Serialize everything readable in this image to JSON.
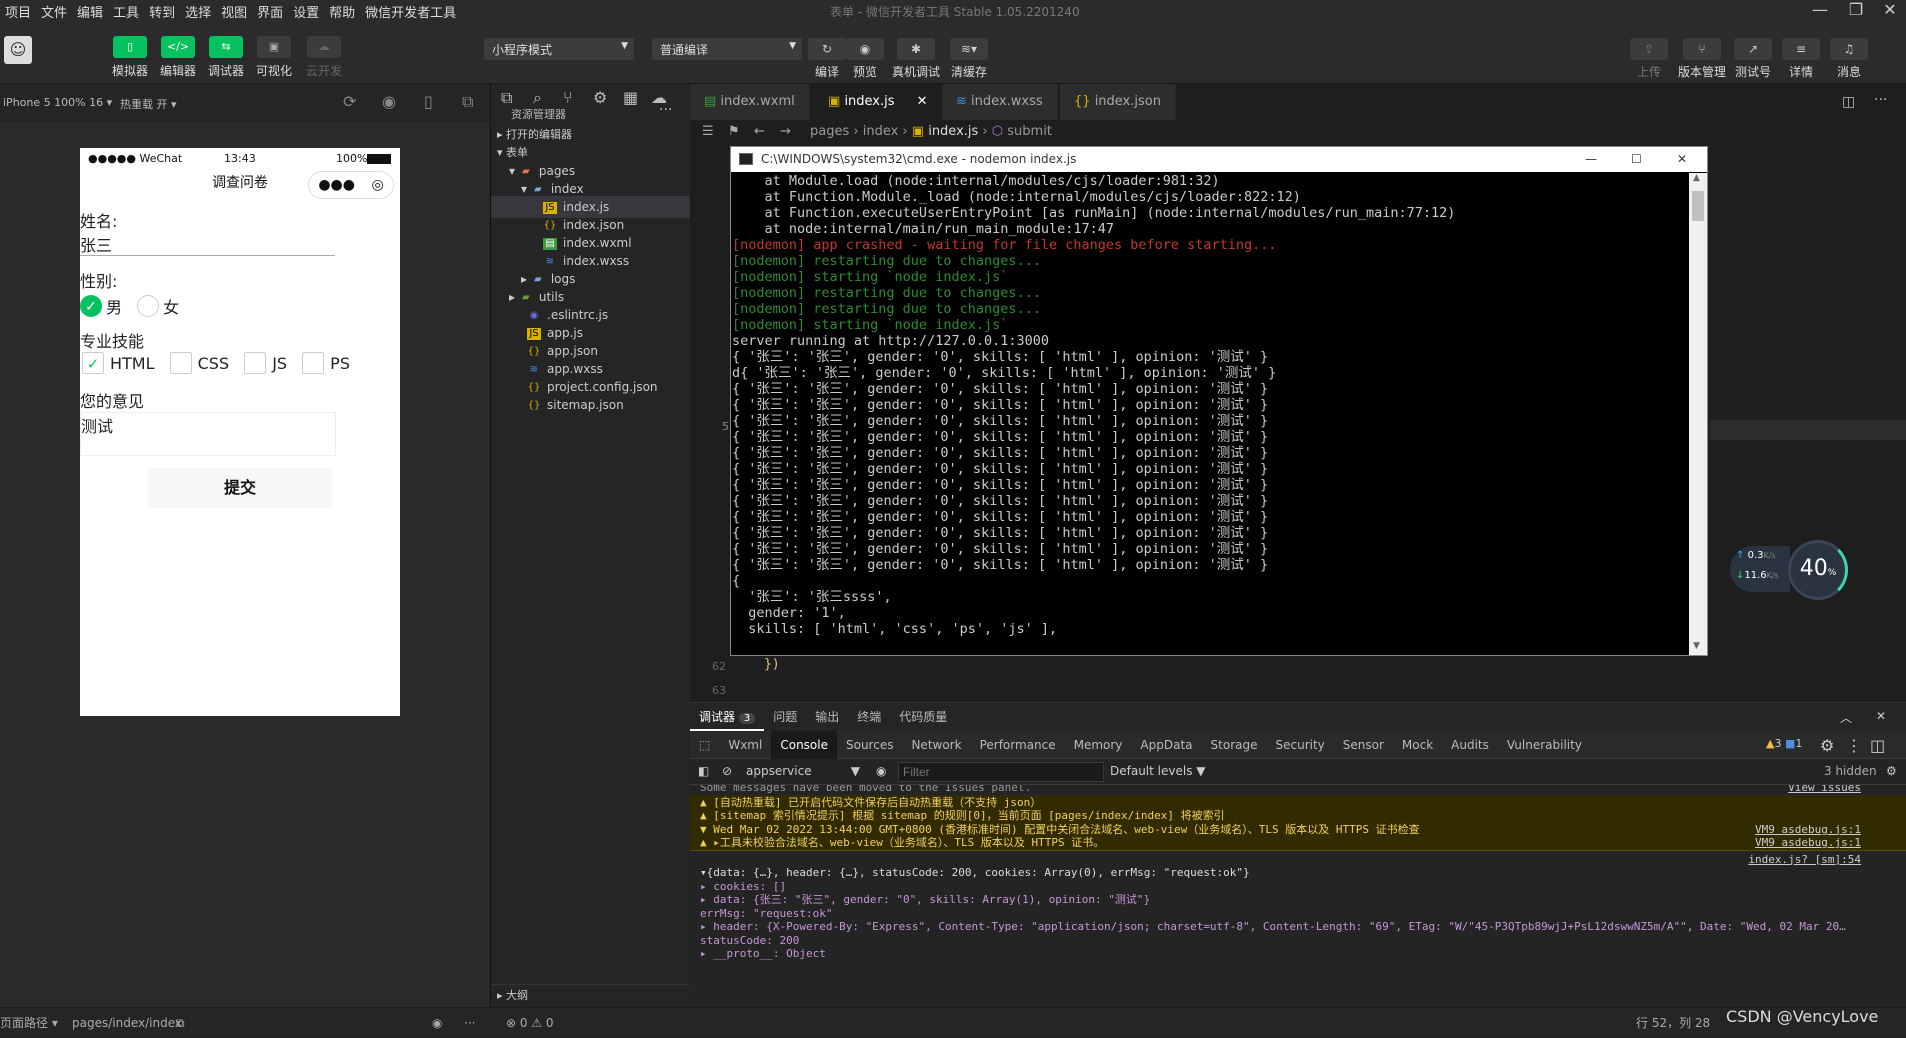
{
  "menu": [
    "项目",
    "文件",
    "编辑",
    "工具",
    "转到",
    "选择",
    "视图",
    "界面",
    "设置",
    "帮助",
    "微信开发者工具"
  ],
  "window_title": "表单 - 微信开发者工具 Stable 1.05.2201240",
  "toolbar": {
    "left": [
      {
        "label": "模拟器",
        "icon": "phone-icon"
      },
      {
        "label": "编辑器",
        "icon": "code-icon"
      },
      {
        "label": "调试器",
        "icon": "debug-icon"
      },
      {
        "label": "可视化",
        "icon": "layout-icon"
      },
      {
        "label": "云开发",
        "icon": "cloud-icon"
      }
    ],
    "mode_select": "小程序模式",
    "compile_select": "普通编译",
    "center": [
      {
        "label": "编译"
      },
      {
        "label": "预览"
      },
      {
        "label": "真机调试"
      },
      {
        "label": "清缓存"
      }
    ],
    "right": [
      {
        "label": "上传"
      },
      {
        "label": "版本管理"
      },
      {
        "label": "测试号"
      },
      {
        "label": "详情"
      },
      {
        "label": "消息"
      }
    ]
  },
  "simbar": {
    "device": "iPhone 5 100% 16",
    "hotreload": "热重载 开"
  },
  "phone": {
    "carrier": "●●●●● WeChat",
    "time": "13:43",
    "battery": "100%",
    "nav_title": "调查问卷",
    "name_label": "姓名:",
    "name_value": "张三",
    "gender_label": "性别:",
    "gender_male": "男",
    "gender_female": "女",
    "skills_label": "专业技能",
    "skills": [
      {
        "label": "HTML",
        "checked": true
      },
      {
        "label": "CSS",
        "checked": false
      },
      {
        "label": "JS",
        "checked": false
      },
      {
        "label": "PS",
        "checked": false
      }
    ],
    "opinion_label": "您的意见",
    "opinion_value": "测试",
    "submit": "提交"
  },
  "explorer": {
    "title": "资源管理器",
    "open_editors": "打开的编辑器",
    "project": "表单",
    "tree": [
      {
        "name": "pages",
        "kind": "folder"
      },
      {
        "name": "index",
        "kind": "folder"
      },
      {
        "name": "index.js",
        "kind": "js"
      },
      {
        "name": "index.json",
        "kind": "json"
      },
      {
        "name": "index.wxml",
        "kind": "wxml"
      },
      {
        "name": "index.wxss",
        "kind": "wxss"
      },
      {
        "name": "logs",
        "kind": "folder"
      },
      {
        "name": "utils",
        "kind": "folder"
      },
      {
        "name": ".eslintrc.js",
        "kind": "eslint"
      },
      {
        "name": "app.js",
        "kind": "js"
      },
      {
        "name": "app.json",
        "kind": "json"
      },
      {
        "name": "app.wxss",
        "kind": "wxss"
      },
      {
        "name": "project.config.json",
        "kind": "json"
      },
      {
        "name": "sitemap.json",
        "kind": "json"
      }
    ],
    "outline": "大纲"
  },
  "editor": {
    "tabs": [
      "index.wxml",
      "index.js",
      "index.wxss",
      "index.json"
    ],
    "breadcrumb": [
      "pages",
      "index",
      "index.js",
      "submit"
    ],
    "line_numbers": [
      "5",
      "62",
      "63"
    ],
    "visible_code": "})"
  },
  "cmd": {
    "title": "C:\\WINDOWS\\system32\\cmd.exe - nodemon  index.js",
    "lines": [
      {
        "t": "    at Module.load (node:internal/modules/cjs/loader:981:32)",
        "c": "#ccc"
      },
      {
        "t": "    at Function.Module._load (node:internal/modules/cjs/loader:822:12)",
        "c": "#ccc"
      },
      {
        "t": "    at Function.executeUserEntryPoint [as runMain] (node:internal/modules/run_main:77:12)",
        "c": "#ccc"
      },
      {
        "t": "    at node:internal/main/run_main_module:17:47",
        "c": "#ccc"
      },
      {
        "t": "[nodemon] app crashed - waiting for file changes before starting...",
        "c": "#c0392b"
      },
      {
        "t": "[nodemon] restarting due to changes...",
        "c": "#2e8b2e"
      },
      {
        "t": "[nodemon] starting `node index.js`",
        "c": "#2e8b2e"
      },
      {
        "t": "[nodemon] restarting due to changes...",
        "c": "#2e8b2e"
      },
      {
        "t": "[nodemon] restarting due to changes...",
        "c": "#2e8b2e"
      },
      {
        "t": "[nodemon] starting `node index.js`",
        "c": "#2e8b2e"
      },
      {
        "t": "server running at http://127.0.0.1:3000",
        "c": "#ccc"
      },
      {
        "t": "{ '张三': '张三', gender: '0', skills: [ 'html' ], opinion: '测试' }",
        "c": "#ccc"
      },
      {
        "t": "d{ '张三': '张三', gender: '0', skills: [ 'html' ], opinion: '测试' }",
        "c": "#ccc"
      },
      {
        "t": "{ '张三': '张三', gender: '0', skills: [ 'html' ], opinion: '测试' }",
        "c": "#ccc"
      },
      {
        "t": "{ '张三': '张三', gender: '0', skills: [ 'html' ], opinion: '测试' }",
        "c": "#ccc"
      },
      {
        "t": "{ '张三': '张三', gender: '0', skills: [ 'html' ], opinion: '测试' }",
        "c": "#ccc"
      },
      {
        "t": "{ '张三': '张三', gender: '0', skills: [ 'html' ], opinion: '测试' }",
        "c": "#ccc"
      },
      {
        "t": "{ '张三': '张三', gender: '0', skills: [ 'html' ], opinion: '测试' }",
        "c": "#ccc"
      },
      {
        "t": "{ '张三': '张三', gender: '0', skills: [ 'html' ], opinion: '测试' }",
        "c": "#ccc"
      },
      {
        "t": "{ '张三': '张三', gender: '0', skills: [ 'html' ], opinion: '测试' }",
        "c": "#ccc"
      },
      {
        "t": "{ '张三': '张三', gender: '0', skills: [ 'html' ], opinion: '测试' }",
        "c": "#ccc"
      },
      {
        "t": "{ '张三': '张三', gender: '0', skills: [ 'html' ], opinion: '测试' }",
        "c": "#ccc"
      },
      {
        "t": "{ '张三': '张三', gender: '0', skills: [ 'html' ], opinion: '测试' }",
        "c": "#ccc"
      },
      {
        "t": "{ '张三': '张三', gender: '0', skills: [ 'html' ], opinion: '测试' }",
        "c": "#ccc"
      },
      {
        "t": "{ '张三': '张三', gender: '0', skills: [ 'html' ], opinion: '测试' }",
        "c": "#ccc"
      },
      {
        "t": "{",
        "c": "#ccc"
      },
      {
        "t": "  '张三': '张三ssss',",
        "c": "#ccc"
      },
      {
        "t": "  gender: '1',",
        "c": "#ccc"
      },
      {
        "t": "  skills: [ 'html', 'css', 'ps', 'js' ],",
        "c": "#ccc"
      }
    ]
  },
  "netwidget": {
    "up": "0.3",
    "up_unit": "K/s",
    "down": "11.6",
    "down_unit": "K/s",
    "percent": "40",
    "percent_unit": "%"
  },
  "devtools": {
    "top_tabs": [
      {
        "label": "调试器",
        "badge": "3"
      },
      {
        "label": "问题"
      },
      {
        "label": "输出"
      },
      {
        "label": "终端"
      },
      {
        "label": "代码质量"
      }
    ],
    "tabs": [
      "Wxml",
      "Console",
      "Sources",
      "Network",
      "Performance",
      "Memory",
      "AppData",
      "Storage",
      "Security",
      "Sensor",
      "Mock",
      "Audits",
      "Vulnerability"
    ],
    "active_tab": "Console",
    "warn_count": "3",
    "info_count": "1",
    "context": "appservice",
    "filter_placeholder": "Filter",
    "levels": "Default levels",
    "hidden": "3 hidden",
    "console": [
      {
        "text": "Some messages have been moved to the Issues panel.",
        "src": "View issues",
        "kind": "plain"
      },
      {
        "text": "▲ [自动热重载] 已开启代码文件保存后自动热重载（不支持 json）",
        "src": "",
        "kind": "warn"
      },
      {
        "text": "▲ [sitemap 索引情况提示] 根据 sitemap 的规则[0]，当前页面 [pages/index/index] 将被索引",
        "src": "",
        "kind": "warn"
      },
      {
        "text": "▼ Wed Mar 02 2022 13:44:00 GMT+0800 (香港标准时间) 配置中关闭合法域名、web-view（业务域名）、TLS 版本以及 HTTPS 证书检查",
        "src": "VM9 asdebug.js:1",
        "kind": "warn"
      },
      {
        "text": "   ▲ ▸工具未校验合法域名、web-view（业务域名）、TLS 版本以及 HTTPS 证书。",
        "src": "VM9 asdebug.js:1",
        "kind": "warn"
      },
      {
        "text": "",
        "src": "index.js? [sm]:54",
        "kind": "plain"
      },
      {
        "text": "  ▾{data: {…}, header: {…}, statusCode: 200, cookies: Array(0), errMsg: \"request:ok\"}",
        "src": "",
        "kind": "obj"
      },
      {
        "text": "    ▸ cookies: []",
        "src": "",
        "kind": "prop"
      },
      {
        "text": "    ▸ data: {张三: \"张三\", gender: \"0\", skills: Array(1), opinion: \"测试\"}",
        "src": "",
        "kind": "prop"
      },
      {
        "text": "      errMsg: \"request:ok\"",
        "src": "",
        "kind": "prop"
      },
      {
        "text": "    ▸ header: {X-Powered-By: \"Express\", Content-Type: \"application/json; charset=utf-8\", Content-Length: \"69\", ETag: \"W/\"45-P3QTpb89wjJ+PsL12dswwNZ5m/A\"\", Date: \"Wed, 02 Mar 20…",
        "src": "",
        "kind": "prop"
      },
      {
        "text": "      statusCode: 200",
        "src": "",
        "kind": "prop"
      },
      {
        "text": "    ▸ __proto__: Object",
        "src": "",
        "kind": "prop"
      }
    ]
  },
  "statusbar": {
    "page_path_label": "页面路径",
    "page_path": "pages/index/index",
    "problems": "⊗ 0 ⚠ 0",
    "cursor": "行 52，列 28",
    "watermark": "CSDN @VencyLove"
  }
}
